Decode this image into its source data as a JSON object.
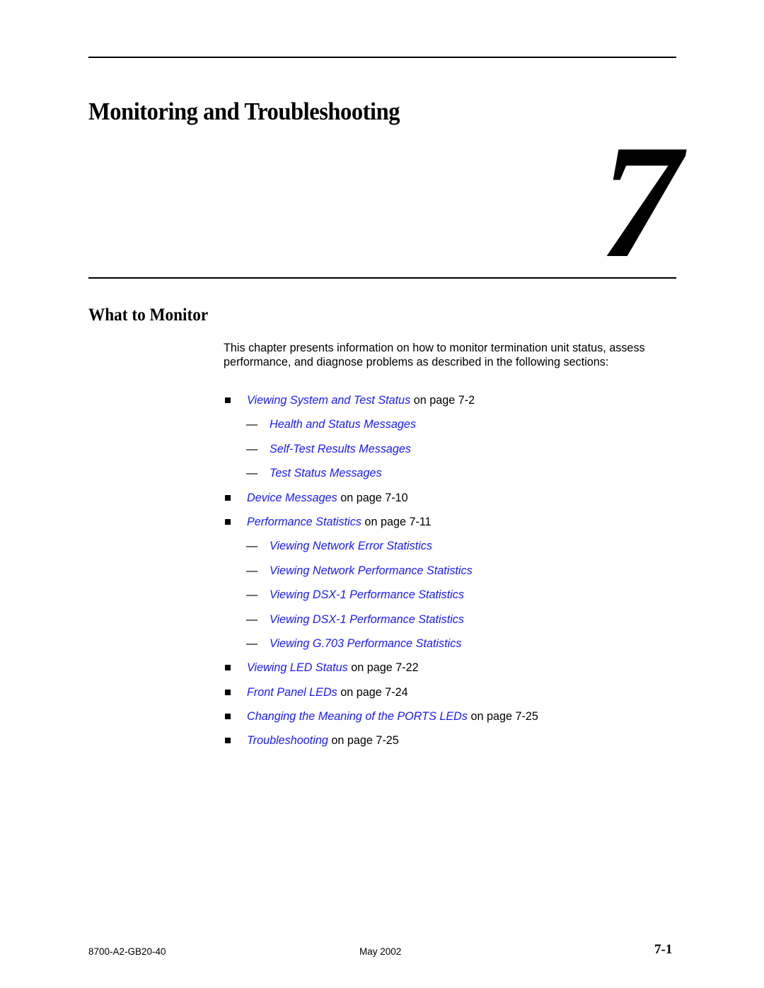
{
  "chapter": {
    "title": "Monitoring and Troubleshooting",
    "number": "7"
  },
  "section": {
    "title": "What to Monitor",
    "intro": "This chapter presents information on how to monitor termination unit status, assess performance, and diagnose problems as described in the following sections:"
  },
  "toc": [
    {
      "level": 1,
      "link": "Viewing System and Test Status",
      "suffix": " on page 7-2"
    },
    {
      "level": 2,
      "link": "Health and Status Messages",
      "suffix": ""
    },
    {
      "level": 2,
      "link": "Self-Test Results Messages",
      "suffix": ""
    },
    {
      "level": 2,
      "link": "Test Status Messages",
      "suffix": ""
    },
    {
      "level": 1,
      "link": "Device Messages",
      "suffix": " on page 7-10"
    },
    {
      "level": 1,
      "link": "Performance Statistics",
      "suffix": " on page 7-11"
    },
    {
      "level": 2,
      "link": "Viewing Network Error Statistics",
      "suffix": ""
    },
    {
      "level": 2,
      "link": "Viewing Network Performance Statistics",
      "suffix": ""
    },
    {
      "level": 2,
      "link": "Viewing DSX-1 Performance Statistics",
      "suffix": ""
    },
    {
      "level": 2,
      "link": "Viewing DSX-1 Performance Statistics",
      "suffix": ""
    },
    {
      "level": 2,
      "link": "Viewing G.703 Performance Statistics",
      "suffix": ""
    },
    {
      "level": 1,
      "link": "Viewing LED Status",
      "suffix": " on page 7-22"
    },
    {
      "level": 1,
      "link": "Front Panel LEDs",
      "suffix": " on page 7-24"
    },
    {
      "level": 1,
      "link": "Changing the Meaning of the PORTS LEDs",
      "suffix": " on page 7-25"
    },
    {
      "level": 1,
      "link": "Troubleshooting",
      "suffix": " on page 7-25"
    }
  ],
  "toc_dash": "—",
  "footer": {
    "doc_number": "8700-A2-GB20-40",
    "date": "May 2002",
    "page": "7-1"
  },
  "colors": {
    "link": "#1a1aff",
    "text": "#000000"
  }
}
